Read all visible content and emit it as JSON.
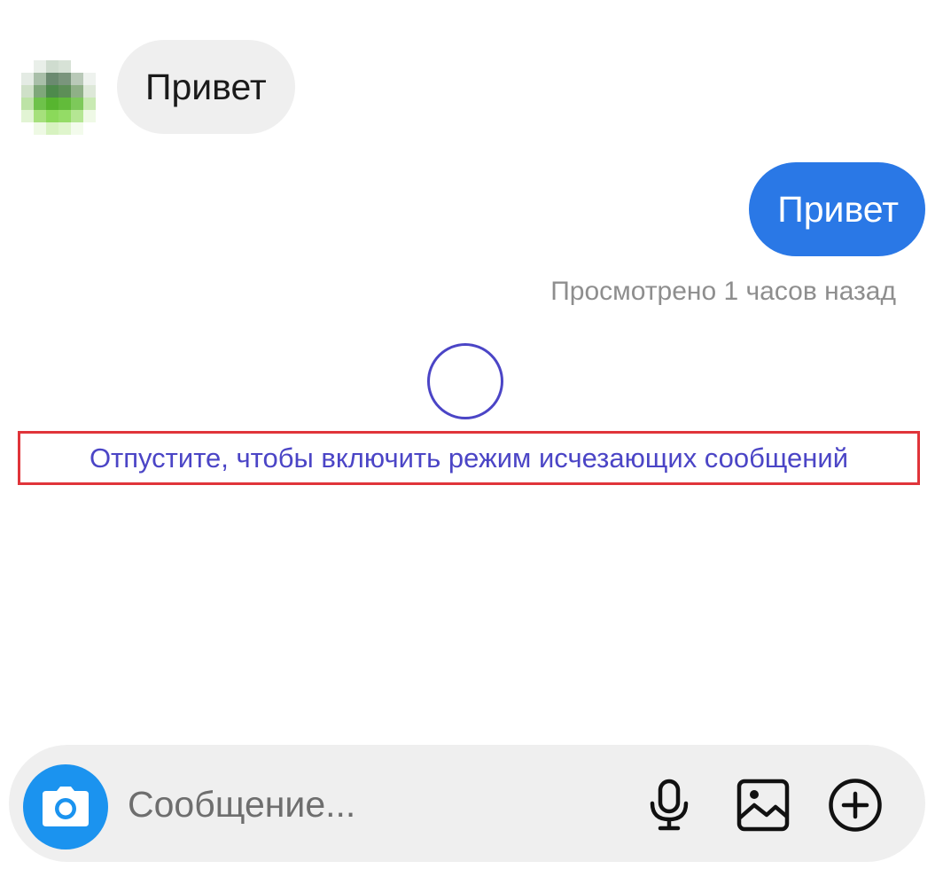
{
  "chat": {
    "incoming_message": "Привет",
    "outgoing_message": "Привет",
    "seen_status": "Просмотрено 1 часов назад",
    "vanish_mode_hint": "Отпустите, чтобы включить режим исчезающих сообщений"
  },
  "composer": {
    "placeholder": "Сообщение...",
    "icons": [
      "camera-icon",
      "microphone-icon",
      "gallery-icon",
      "add-icon"
    ]
  },
  "colors": {
    "outgoing_bubble": "#2a78e6",
    "incoming_bubble": "#efefef",
    "hint_text": "#4b45c6",
    "highlight_border": "#e0343a",
    "camera_button": "#1b93ef"
  }
}
